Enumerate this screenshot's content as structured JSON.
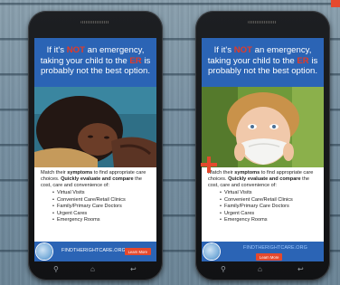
{
  "ad": {
    "headline": {
      "line1_pre": "If it's ",
      "line1_emph": "NOT",
      "line1_post": " an emergency,",
      "line2_pre": "taking your child to the ",
      "line2_emph": "ER",
      "line2_post": " is",
      "line3": "probably not the best option."
    },
    "body": {
      "part1": "Match their ",
      "part1_bold": "symptoms",
      "part2": " to find appropriate care choices. ",
      "part2_bold": "Quickly evaluate and compare",
      "part3": " the cost, care and convenience of:"
    },
    "bullets": [
      "Virtual Visits",
      "Convenient Care/Retail Clinics",
      "Family/Primary Care Doctors",
      "Urgent Cares",
      "Emergency Rooms"
    ],
    "footer_url": "FINDTHERIGHTCARE.ORG",
    "learn_more": "Learn More"
  },
  "colors": {
    "headline_bg": "#2b64b5",
    "emphasis_red": "#e53a26",
    "button_orange": "#e5492d"
  },
  "icons": [
    "search-icon",
    "home-icon",
    "back-icon",
    "plus-icon",
    "logo-globe-icon"
  ]
}
